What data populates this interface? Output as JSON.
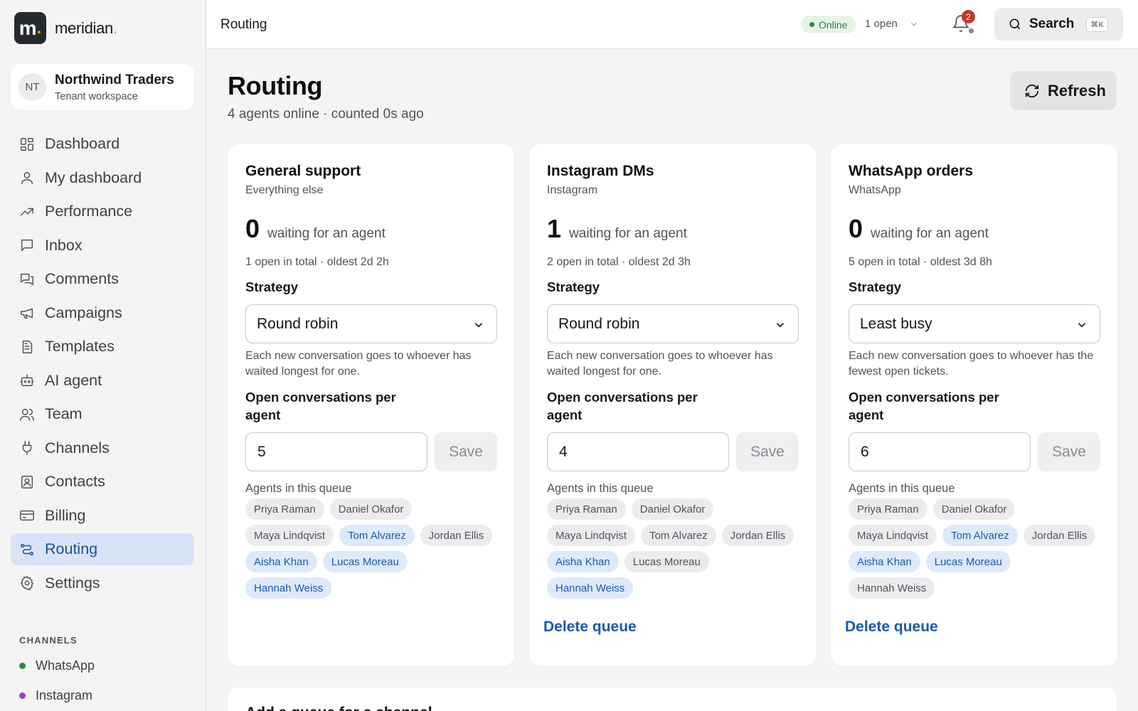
{
  "brand": {
    "logo_letter": "m",
    "name": "meridian"
  },
  "workspace": {
    "initials": "NT",
    "name": "Northwind Traders",
    "subtitle": "Tenant workspace"
  },
  "nav": [
    {
      "label": "Dashboard",
      "icon": "grid-icon"
    },
    {
      "label": "My dashboard",
      "icon": "user-icon"
    },
    {
      "label": "Performance",
      "icon": "trending-up-icon"
    },
    {
      "label": "Inbox",
      "icon": "chat-bubble-icon"
    },
    {
      "label": "Comments",
      "icon": "comments-icon"
    },
    {
      "label": "Campaigns",
      "icon": "megaphone-icon"
    },
    {
      "label": "Templates",
      "icon": "document-icon"
    },
    {
      "label": "AI agent",
      "icon": "robot-icon"
    },
    {
      "label": "Team",
      "icon": "users-icon"
    },
    {
      "label": "Channels",
      "icon": "plug-icon"
    },
    {
      "label": "Contacts",
      "icon": "contact-book-icon"
    },
    {
      "label": "Billing",
      "icon": "credit-card-icon"
    },
    {
      "label": "Routing",
      "icon": "routing-icon",
      "active": true
    },
    {
      "label": "Settings",
      "icon": "gear-icon"
    }
  ],
  "channels": {
    "heading": "CHANNELS",
    "items": [
      {
        "label": "WhatsApp",
        "color": "#2f8a3f"
      },
      {
        "label": "Instagram",
        "color": "#9b3fc4"
      }
    ]
  },
  "topbar": {
    "title": "Routing",
    "status": "Online",
    "open_count": "1 open",
    "notifications": "2",
    "search_label": "Search",
    "search_shortcut": "⌘K"
  },
  "page": {
    "title": "Routing",
    "subtitle": "4 agents online · counted 0s ago",
    "refresh_label": "Refresh"
  },
  "labels": {
    "waiting": "waiting for an agent",
    "strategy": "Strategy",
    "capacity": "Open conversations per agent",
    "save": "Save",
    "agents": "Agents in this queue",
    "delete": "Delete queue"
  },
  "queues": [
    {
      "name": "General support",
      "channel": "Everything else",
      "waiting": "0",
      "open_summary": "1 open in total · oldest 2d 2h",
      "strategy": "Round robin",
      "strategy_desc": "Each new conversation goes to whoever has waited longest for one.",
      "capacity": "5",
      "deletable": false,
      "agents": [
        {
          "name": "Priya Raman",
          "selected": false
        },
        {
          "name": "Daniel Okafor",
          "selected": false
        },
        {
          "name": "Maya Lindqvist",
          "selected": false
        },
        {
          "name": "Tom Alvarez",
          "selected": true
        },
        {
          "name": "Jordan Ellis",
          "selected": false
        },
        {
          "name": "Aisha Khan",
          "selected": true
        },
        {
          "name": "Lucas Moreau",
          "selected": true
        },
        {
          "name": "Hannah Weiss",
          "selected": true
        }
      ]
    },
    {
      "name": "Instagram DMs",
      "channel": "Instagram",
      "waiting": "1",
      "open_summary": "2 open in total · oldest 2d 3h",
      "strategy": "Round robin",
      "strategy_desc": "Each new conversation goes to whoever has waited longest for one.",
      "capacity": "4",
      "deletable": true,
      "agents": [
        {
          "name": "Priya Raman",
          "selected": false
        },
        {
          "name": "Daniel Okafor",
          "selected": false
        },
        {
          "name": "Maya Lindqvist",
          "selected": false
        },
        {
          "name": "Tom Alvarez",
          "selected": false
        },
        {
          "name": "Jordan Ellis",
          "selected": false
        },
        {
          "name": "Aisha Khan",
          "selected": true
        },
        {
          "name": "Lucas Moreau",
          "selected": false
        },
        {
          "name": "Hannah Weiss",
          "selected": true
        }
      ]
    },
    {
      "name": "WhatsApp orders",
      "channel": "WhatsApp",
      "waiting": "0",
      "open_summary": "5 open in total · oldest 3d 8h",
      "strategy": "Least busy",
      "strategy_desc": "Each new conversation goes to whoever has the fewest open tickets.",
      "capacity": "6",
      "deletable": true,
      "agents": [
        {
          "name": "Priya Raman",
          "selected": false
        },
        {
          "name": "Daniel Okafor",
          "selected": false
        },
        {
          "name": "Maya Lindqvist",
          "selected": false
        },
        {
          "name": "Tom Alvarez",
          "selected": true
        },
        {
          "name": "Jordan Ellis",
          "selected": false
        },
        {
          "name": "Aisha Khan",
          "selected": true
        },
        {
          "name": "Lucas Moreau",
          "selected": true
        },
        {
          "name": "Hannah Weiss",
          "selected": false
        }
      ]
    }
  ],
  "add_queue": {
    "title": "Add a queue for a channel"
  }
}
